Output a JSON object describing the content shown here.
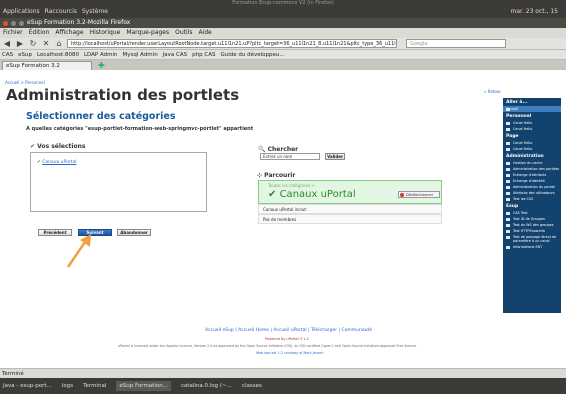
{
  "window_title": "Formation Esup-commons V2 (in Firefox)",
  "topbar": {
    "menu": [
      "Applications",
      "Raccourcis",
      "Système"
    ],
    "clock": "mar. 23 oct., 15"
  },
  "firefox": {
    "title": "eSup Formation 3.2-Mozilla Firefox",
    "menu": [
      "Fichier",
      "Édition",
      "Affichage",
      "Historique",
      "Marque-pages",
      "Outils",
      "Aide"
    ],
    "url": "http://localhost/uPortal/render.userLayoutRootNode.target.u11l1n21.uP?pltc_target=36_u11l1n21_8.u11l1n21&pltc_type_36_u11l1n21_8.u11l1n21=ACTI",
    "search_placeholder": "Google",
    "bookmarks": [
      "CAS",
      "eSup",
      "Localhost:8080",
      "LDAP Admin",
      "Mysql Admin",
      "Java CAS",
      "php CAS",
      "Guide du développeu..."
    ],
    "tab": "eSup Formation 3.2",
    "status": "Terminé"
  },
  "page": {
    "breadcrumb": "Accueil > Personnel",
    "title": "Administration des portlets",
    "retour": "« Retour",
    "subtitle": "Sélectionner des catégories",
    "question": "A quelles catégories \"esup-portlet-formation-web-springmvc-portlet\" appartient",
    "selections_label": "Vos sélections",
    "selected_item": "Canaux uPortal",
    "btn_prev": "Précédent",
    "btn_next": "Suivant",
    "btn_cancel": "Abandonner",
    "chercher_label": "Chercher",
    "search_value": "Entrez un nom",
    "btn_valider": "Valider",
    "parcourir_label": "Parcourir",
    "all_categories": "Toutes les catégories >",
    "category": "Canaux uPortal",
    "deselect": "Désélectionner",
    "inclus": "Canaux uPortal inclut:",
    "pas_membres": "Pas de membres"
  },
  "sidebar": {
    "groups": [
      {
        "title": "Aller à...",
        "items": [
          "Accueil"
        ]
      },
      {
        "title": "Personnel",
        "items": [
          "Canal Hello",
          "Canal Hello"
        ]
      },
      {
        "title": "Page",
        "items": [
          "Canal Hello",
          "Canal Hello"
        ]
      },
      {
        "title": "Administration",
        "items": [
          "Gestion du cache",
          "Administration des portlets",
          "Echange d'attributs",
          "Echange d'identité",
          "Administration du portail",
          "Attributs des utilisateurs",
          "Test les CSS"
        ]
      },
      {
        "title": "Esup",
        "items": [
          "CAS Test",
          "Test ID de Groupes",
          "Test du WS des groupes",
          "Test HTTPShowInfo",
          "Test de passage direct de paramètre à un canal",
          "Informations ENT"
        ]
      }
    ]
  },
  "footer": {
    "links": "Accueil eSup | Accueil Home | Accueil uPortal | Télécharger | Communauté",
    "powered": "Powered by uPortal 3.1.2",
    "license": "uPortal is licensed under the Apache License, Version 2.0 as approved by the Open Source Initiative (OSI), an OSI-certified ('open') and Open-Source Initiative-approved Free license.",
    "webapp": "Web tool set 1.2 courtesy of Mark Jensen"
  },
  "taskbar": [
    "Java - esup-port...",
    "logs",
    "Terminal",
    "eSup Formation...",
    "catalina.0.log (~...",
    "classes"
  ]
}
